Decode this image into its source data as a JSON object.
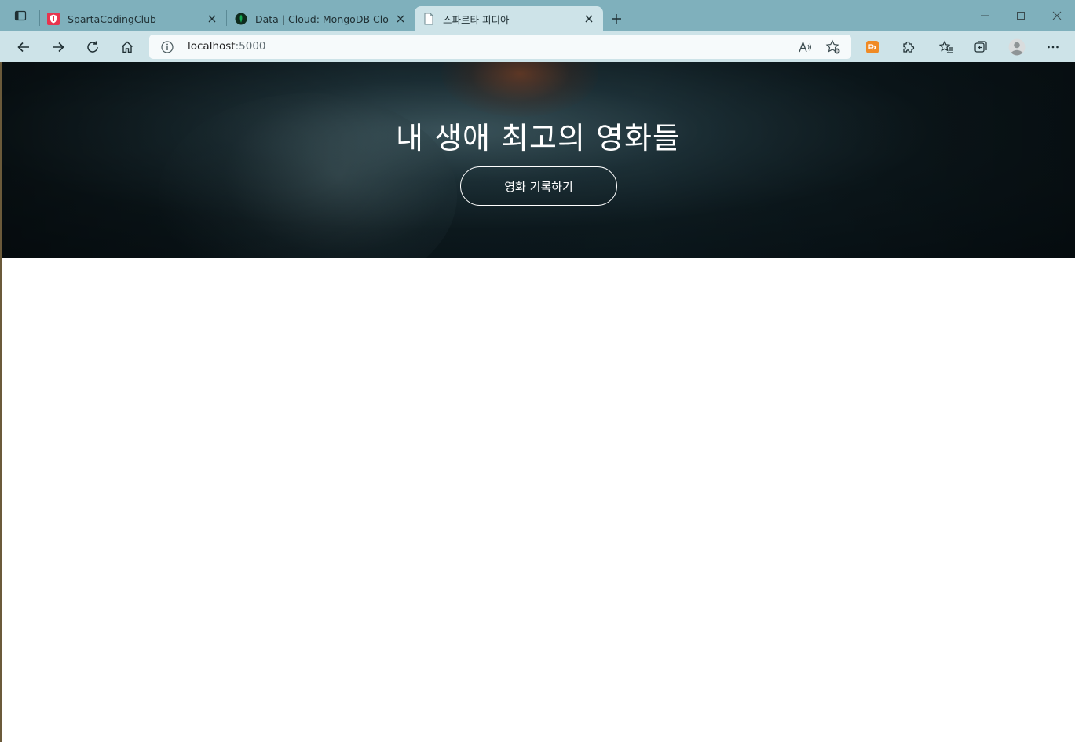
{
  "tabs": [
    {
      "title": "SpartaCodingClub",
      "favicon": "sparta-icon",
      "active": false
    },
    {
      "title": "Data | Cloud: MongoDB Cloud",
      "favicon": "mongodb-leaf-icon",
      "active": false
    },
    {
      "title": "스파르타 피디아",
      "favicon": "blank-page-icon",
      "active": true
    }
  ],
  "toolbar": {
    "url_host": "localhost",
    "url_port": ":5000"
  },
  "hero": {
    "title": "내 생애 최고의 영화들",
    "button_label": "영화 기록하기"
  },
  "colors": {
    "tabstrip": "#7fb0bc",
    "toolbar": "#cde3e8",
    "hero_text": "#ffffff"
  }
}
